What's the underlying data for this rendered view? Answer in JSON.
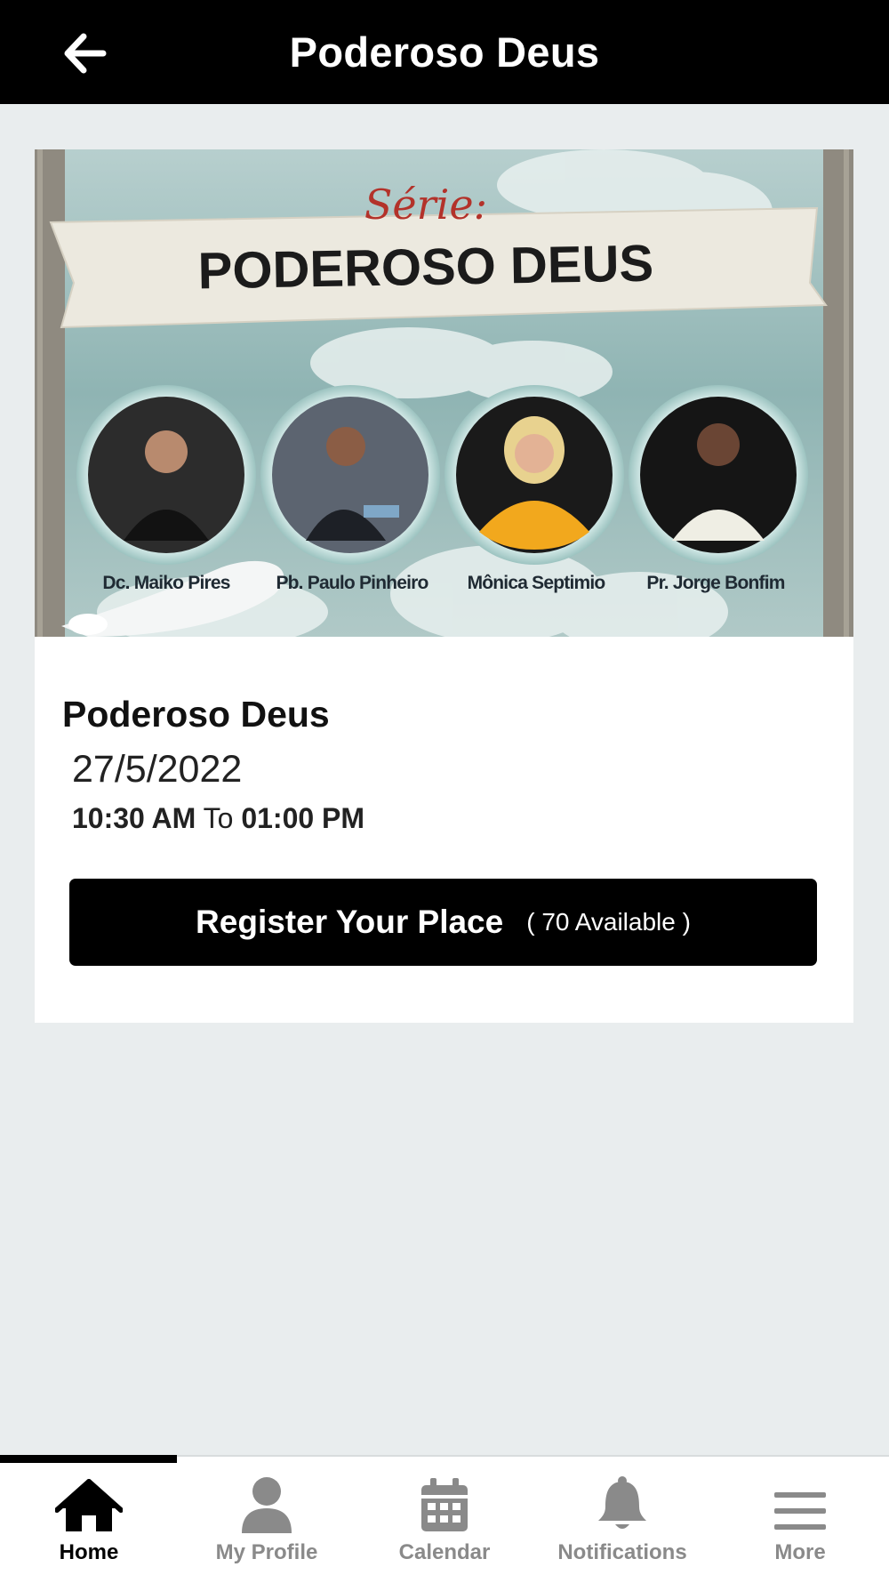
{
  "header": {
    "title": "Poderoso Deus",
    "back_icon": "arrow-left-icon"
  },
  "banner": {
    "series_label": "Série:",
    "headline": "PODEROSO DEUS",
    "speakers": [
      {
        "name": "Dc. Maiko Pires"
      },
      {
        "name": "Pb. Paulo Pinheiro"
      },
      {
        "name": "Mônica Septimio"
      },
      {
        "name": "Pr. Jorge Bonfim"
      }
    ]
  },
  "event": {
    "title": "Poderoso Deus",
    "date": "27/5/2022",
    "start": "10:30 AM",
    "to": "To",
    "end": "01:00 PM"
  },
  "register": {
    "label": "Register Your Place",
    "available": "( 70 Available )"
  },
  "tabs": [
    {
      "label": "Home",
      "icon": "home-icon",
      "active": true
    },
    {
      "label": "My Profile",
      "icon": "user-icon",
      "active": false
    },
    {
      "label": "Calendar",
      "icon": "calendar-icon",
      "active": false
    },
    {
      "label": "Notifications",
      "icon": "bell-icon",
      "active": false
    },
    {
      "label": "More",
      "icon": "menu-icon",
      "active": false
    }
  ],
  "colors": {
    "header_bg": "#000000",
    "page_bg": "#e9edee",
    "button_bg": "#000000",
    "tab_inactive": "#8a8a8a",
    "accent_script": "#b3322a"
  }
}
